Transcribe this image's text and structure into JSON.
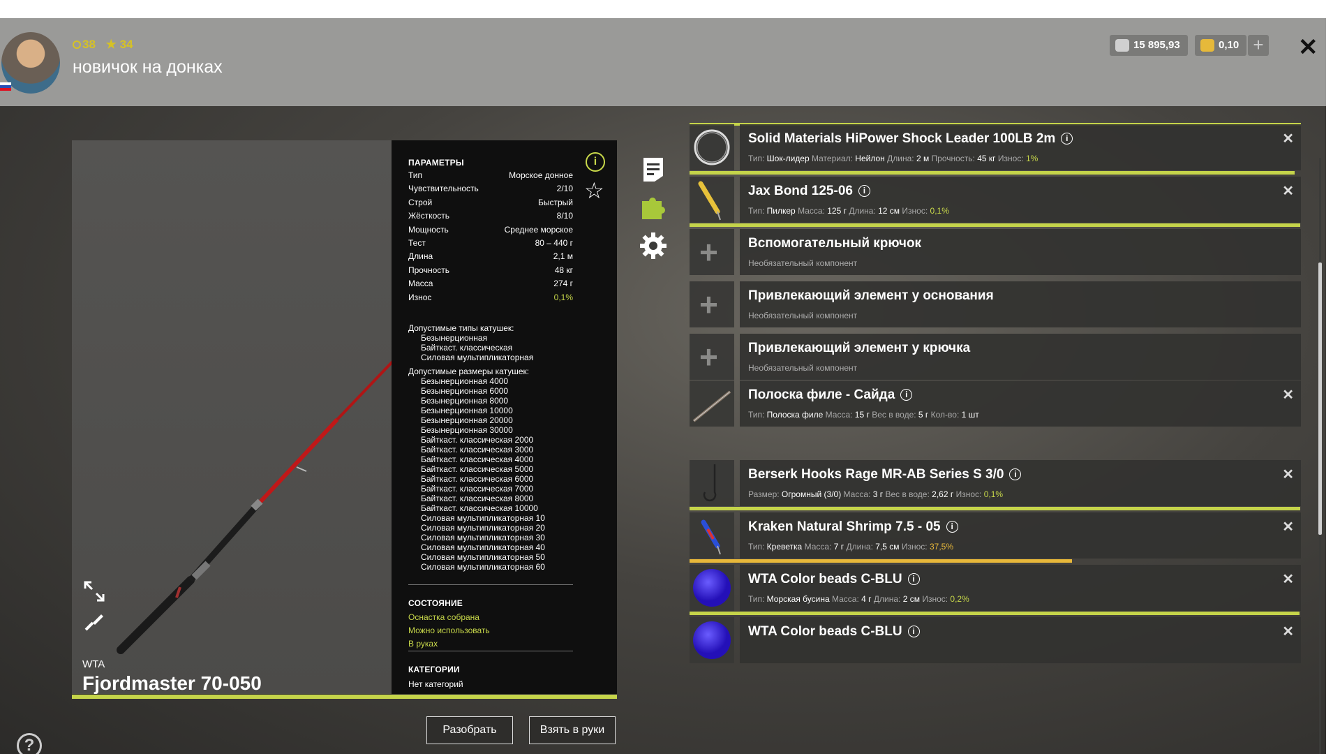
{
  "player": {
    "level": "38",
    "stars": "34",
    "title": "новичок на донках"
  },
  "currency": {
    "silver": "15 895,93",
    "gold": "0,10"
  },
  "rod": {
    "maker": "WTA",
    "name": "Fjordmaster 70-050"
  },
  "params": {
    "header": "ПАРАМЕТРЫ",
    "rows": [
      {
        "k": "Тип",
        "v": "Морское донное"
      },
      {
        "k": "Чувствительность",
        "v": "2/10"
      },
      {
        "k": "Строй",
        "v": "Быстрый"
      },
      {
        "k": "Жёсткость",
        "v": "8/10"
      },
      {
        "k": "Мощность",
        "v": "Среднее морское"
      },
      {
        "k": "Тест",
        "v": "80 – 440 г"
      },
      {
        "k": "Длина",
        "v": "2,1 м"
      },
      {
        "k": "Прочность",
        "v": "48 кг"
      },
      {
        "k": "Масса",
        "v": "274 г"
      },
      {
        "k": "Износ",
        "v": "0,1%"
      }
    ],
    "reel_types_label": "Допустимые типы катушек:",
    "reel_types": [
      "Безынерционная",
      "Байткаст. классическая",
      "Силовая мультипликаторная"
    ],
    "reel_sizes_label": "Допустимые размеры катушек:",
    "reel_sizes": [
      "Безынерционная 4000",
      "Безынерционная 6000",
      "Безынерционная 8000",
      "Безынерционная 10000",
      "Безынерционная 20000",
      "Безынерционная 30000",
      "Байткаст. классическая 2000",
      "Байткаст. классическая 3000",
      "Байткаст. классическая 4000",
      "Байткаст. классическая 5000",
      "Байткаст. классическая 6000",
      "Байткаст. классическая 7000",
      "Байткаст. классическая 8000",
      "Байткаст. классическая 10000",
      "Силовая мультипликаторная 10",
      "Силовая мультипликаторная 20",
      "Силовая мультипликаторная 30",
      "Силовая мультипликаторная 40",
      "Силовая мультипликаторная 50",
      "Силовая мультипликаторная 60"
    ],
    "state_header": "СОСТОЯНИЕ",
    "states": [
      "Оснастка собрана",
      "Можно использовать",
      "В руках"
    ],
    "cat_header": "КАТЕГОРИИ",
    "categories": "Нет категорий",
    "info_glyph": "i"
  },
  "buttons": {
    "disassemble": "Разобрать",
    "take": "Взять в руки"
  },
  "help_glyph": "?",
  "slots": [
    {
      "name": "Solid Materials HiPower Shock Leader 100LB 2m",
      "desc": [
        [
          "Тип:",
          "Шок-лидер"
        ],
        [
          "Материал:",
          "Нейлон"
        ],
        [
          "Длина:",
          "2 м"
        ],
        [
          "Прочность:",
          "45 кг"
        ]
      ],
      "wear_label": "Износ:",
      "wear": "1%",
      "wear_fraction": 0.99,
      "thumb": "line-coil-icon"
    },
    {
      "name": "Jax Bond 125-06",
      "desc": [
        [
          "Тип:",
          "Пилкер"
        ],
        [
          "Масса:",
          "125 г"
        ],
        [
          "Длина:",
          "12 см"
        ]
      ],
      "wear_label": "Износ:",
      "wear": "0,1%",
      "wear_fraction": 0.999,
      "thumb": "pilker-lure-icon"
    },
    {
      "name": "Вспомогательный крючок",
      "optional": "Необязательный компонент",
      "empty": true
    },
    {
      "name": "Привлекающий элемент у основания",
      "optional": "Необязательный компонент",
      "empty": true
    },
    {
      "name": "Привлекающий элемент у крючка",
      "optional": "Необязательный компонент",
      "empty": true
    },
    {
      "name": "Полоска филе - Сайда",
      "desc": [
        [
          "Тип:",
          "Полоска филе"
        ],
        [
          "Масса:",
          "15 г"
        ],
        [
          "Вес в воде:",
          "5 г"
        ],
        [
          "Кол-во:",
          "1 шт"
        ]
      ],
      "thumb": "fish-strip-icon"
    },
    {
      "name": "Berserk Hooks Rage MR-AB Series S 3/0",
      "desc": [
        [
          "Размер:",
          "Огромный (3/0)"
        ],
        [
          "Масса:",
          "3 г"
        ],
        [
          "Вес в воде:",
          "2,62 г"
        ]
      ],
      "wear_label": "Износ:",
      "wear": "0,1%",
      "wear_fraction": 0.999,
      "thumb": "hook-icon"
    },
    {
      "name": "Kraken Natural Shrimp 7.5 - 05",
      "desc": [
        [
          "Тип:",
          "Креветка"
        ],
        [
          "Масса:",
          "7 г"
        ],
        [
          "Длина:",
          "7,5 см"
        ]
      ],
      "wear_label": "Износ:",
      "wear": "37,5%",
      "wear_fraction": 0.625,
      "wear_color": "#e8b83a",
      "thumb": "shrimp-lure-icon"
    },
    {
      "name": "WTA Color beads C-BLU",
      "desc": [
        [
          "Тип:",
          "Морская бусина"
        ],
        [
          "Масса:",
          "4 г"
        ],
        [
          "Длина:",
          "2 см"
        ]
      ],
      "wear_label": "Износ:",
      "wear": "0,2%",
      "wear_fraction": 0.998,
      "thumb": "blue-bead-icon"
    },
    {
      "name": "WTA Color beads C-BLU",
      "thumb": "blue-bead-icon"
    }
  ],
  "colors": {
    "accent": "#c5d44a",
    "warn": "#e8b83a",
    "bead": "#3b1fd8"
  }
}
